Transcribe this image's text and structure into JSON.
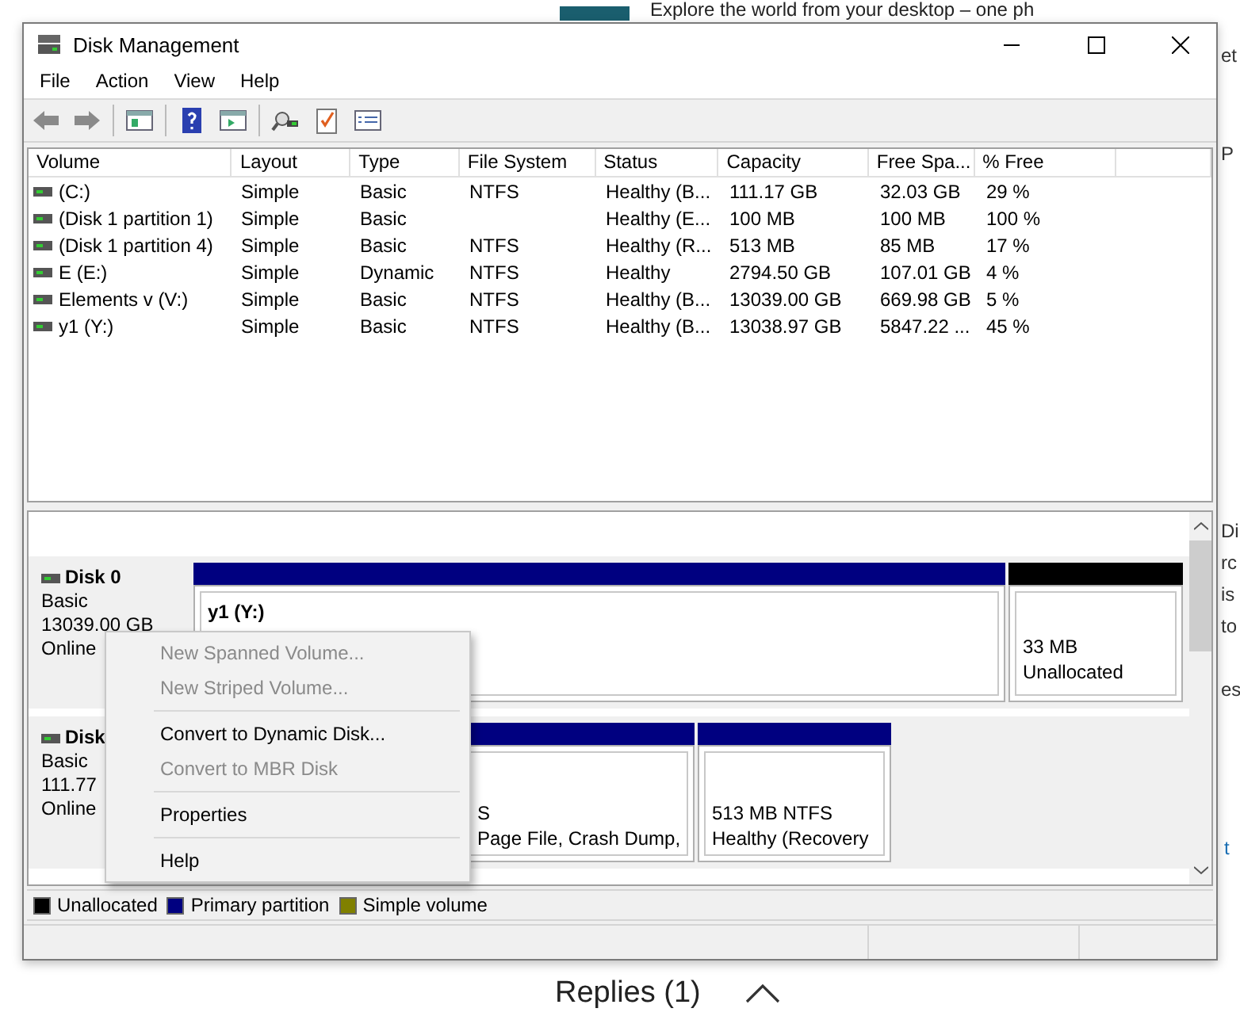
{
  "background_page": {
    "headline": "Explore the world from your desktop – one ph",
    "fragments": [
      "et",
      "P",
      "Di",
      "rc",
      "is",
      "to",
      "es"
    ],
    "link_fragment": "t",
    "replies": "Replies (1)"
  },
  "window": {
    "title": "Disk Management"
  },
  "menu": [
    "File",
    "Action",
    "View",
    "Help"
  ],
  "columns": [
    "Volume",
    "Layout",
    "Type",
    "File System",
    "Status",
    "Capacity",
    "Free Spa...",
    "% Free"
  ],
  "rows": [
    {
      "cells": [
        " (C:)",
        "Simple",
        "Basic",
        "NTFS",
        "Healthy (B...",
        "111.17 GB",
        "32.03 GB",
        "29 %"
      ]
    },
    {
      "cells": [
        "(Disk 1 partition 1)",
        "Simple",
        "Basic",
        "",
        "Healthy (E...",
        "100 MB",
        "100 MB",
        "100 %"
      ]
    },
    {
      "cells": [
        "(Disk 1 partition 4)",
        "Simple",
        "Basic",
        "NTFS",
        "Healthy (R...",
        "513 MB",
        "85 MB",
        "17 %"
      ]
    },
    {
      "cells": [
        "E (E:)",
        "Simple",
        "Dynamic",
        "NTFS",
        "Healthy",
        "2794.50 GB",
        "107.01 GB",
        "4 %"
      ]
    },
    {
      "cells": [
        "Elements v (V:)",
        "Simple",
        "Basic",
        "NTFS",
        "Healthy (B...",
        "13039.00 GB",
        "669.98 GB",
        "5 %"
      ]
    },
    {
      "cells": [
        "y1 (Y:)",
        "Simple",
        "Basic",
        "NTFS",
        "Healthy (B...",
        "13038.97 GB",
        "5847.22 ...",
        "45 %"
      ]
    }
  ],
  "disks": [
    {
      "name": "Disk 0",
      "type": "Basic",
      "size": "13039.00 GB",
      "status": "Online",
      "partitions": [
        {
          "kind": "primary",
          "title": "y1  (Y:)"
        },
        {
          "kind": "unallocated",
          "lines": [
            "33 MB",
            "Unallocated"
          ]
        }
      ]
    },
    {
      "name": "Disk",
      "type": "Basic",
      "size": "111.77",
      "status": "Online",
      "partitions": [
        {
          "kind": "primary",
          "lines": [
            "S",
            "Page File, Crash Dump,"
          ]
        },
        {
          "kind": "primary",
          "lines": [
            "513 MB NTFS",
            "Healthy (Recovery"
          ]
        }
      ]
    }
  ],
  "context_menu": [
    {
      "kind": "item",
      "label": "New Spanned Volume...",
      "disabled": true
    },
    {
      "kind": "item",
      "label": "New Striped Volume...",
      "disabled": true
    },
    {
      "kind": "separator"
    },
    {
      "kind": "item",
      "label": "Convert to Dynamic Disk...",
      "disabled": false
    },
    {
      "kind": "item",
      "label": "Convert to MBR Disk",
      "disabled": true
    },
    {
      "kind": "separator"
    },
    {
      "kind": "item",
      "label": "Properties",
      "disabled": false
    },
    {
      "kind": "separator"
    },
    {
      "kind": "item",
      "label": "Help",
      "disabled": false
    }
  ],
  "legend": [
    {
      "label": "Unallocated",
      "color": "#000000"
    },
    {
      "label": "Primary partition",
      "color": "#000080"
    },
    {
      "label": "Simple volume",
      "color": "#808000"
    }
  ]
}
